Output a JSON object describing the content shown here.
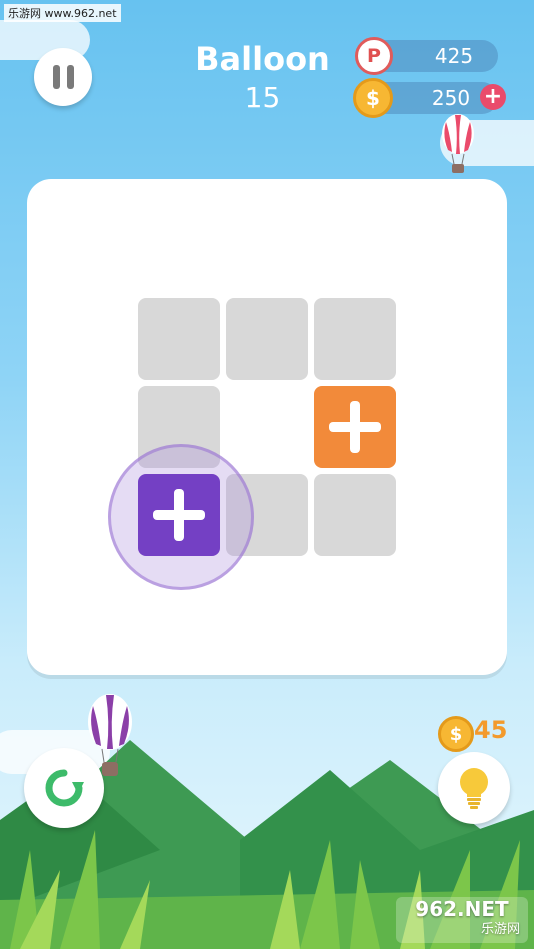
{
  "watermark": "乐游网 www.962.net",
  "header": {
    "title": "Balloon",
    "level": "15",
    "points": {
      "icon_letter": "P",
      "value": "425"
    },
    "coins": {
      "icon_letter": "$",
      "value": "250",
      "add_label": "+"
    }
  },
  "board": {
    "grid": [
      [
        "empty",
        "empty",
        "empty"
      ],
      [
        "empty",
        "blank",
        "orange-plus"
      ],
      [
        "purple-plus",
        "empty",
        "empty"
      ]
    ],
    "selected_tile": "purple-plus"
  },
  "hint": {
    "cost_icon_letter": "$",
    "cost": "45"
  },
  "brand_watermark": {
    "main": "962.NET",
    "sub": "乐游网"
  },
  "colors": {
    "purple": "#7440c4",
    "orange": "#f28a3a",
    "empty_cell": "#d8d8d8",
    "restart_arrow": "#3dbb6a",
    "bulb": "#f7c93a"
  }
}
